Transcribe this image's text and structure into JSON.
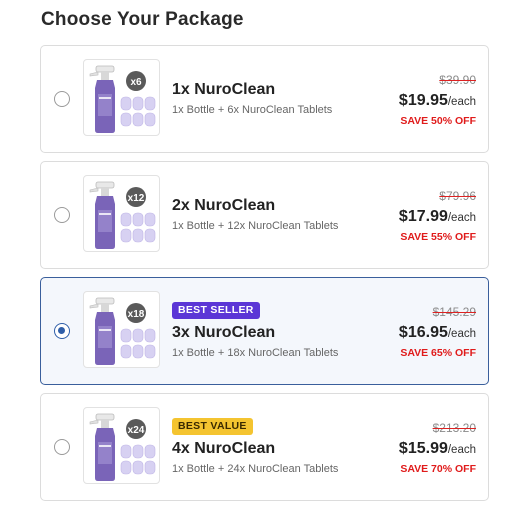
{
  "page": {
    "title": "Choose Your Package"
  },
  "colors": {
    "accent": "#2f5ea8",
    "best_seller": "#5b36d6",
    "best_value": "#f4c430",
    "save": "#e01b1b"
  },
  "packages": [
    {
      "name": "1x NuroClean",
      "description": "1x Bottle + 6x NuroClean Tablets",
      "tablet_count": "x6",
      "old_price": "$39.90",
      "price": "$19.95",
      "per": "/each",
      "save": "SAVE 50% OFF",
      "badge": "",
      "selected": false
    },
    {
      "name": "2x NuroClean",
      "description": "1x Bottle + 12x NuroClean Tablets",
      "tablet_count": "x12",
      "old_price": "$79.96",
      "price": "$17.99",
      "per": "/each",
      "save": "SAVE 55% OFF",
      "badge": "",
      "selected": false
    },
    {
      "name": "3x NuroClean",
      "description": "1x Bottle + 18x NuroClean Tablets",
      "tablet_count": "x18",
      "old_price": "$145.29",
      "price": "$16.95",
      "per": "/each",
      "save": "SAVE 65% OFF",
      "badge": "BEST SELLER",
      "selected": true
    },
    {
      "name": "4x NuroClean",
      "description": "1x Bottle + 24x NuroClean Tablets",
      "tablet_count": "x24",
      "old_price": "$213.20",
      "price": "$15.99",
      "per": "/each",
      "save": "SAVE 70% OFF",
      "badge": "BEST VALUE",
      "selected": false
    }
  ]
}
